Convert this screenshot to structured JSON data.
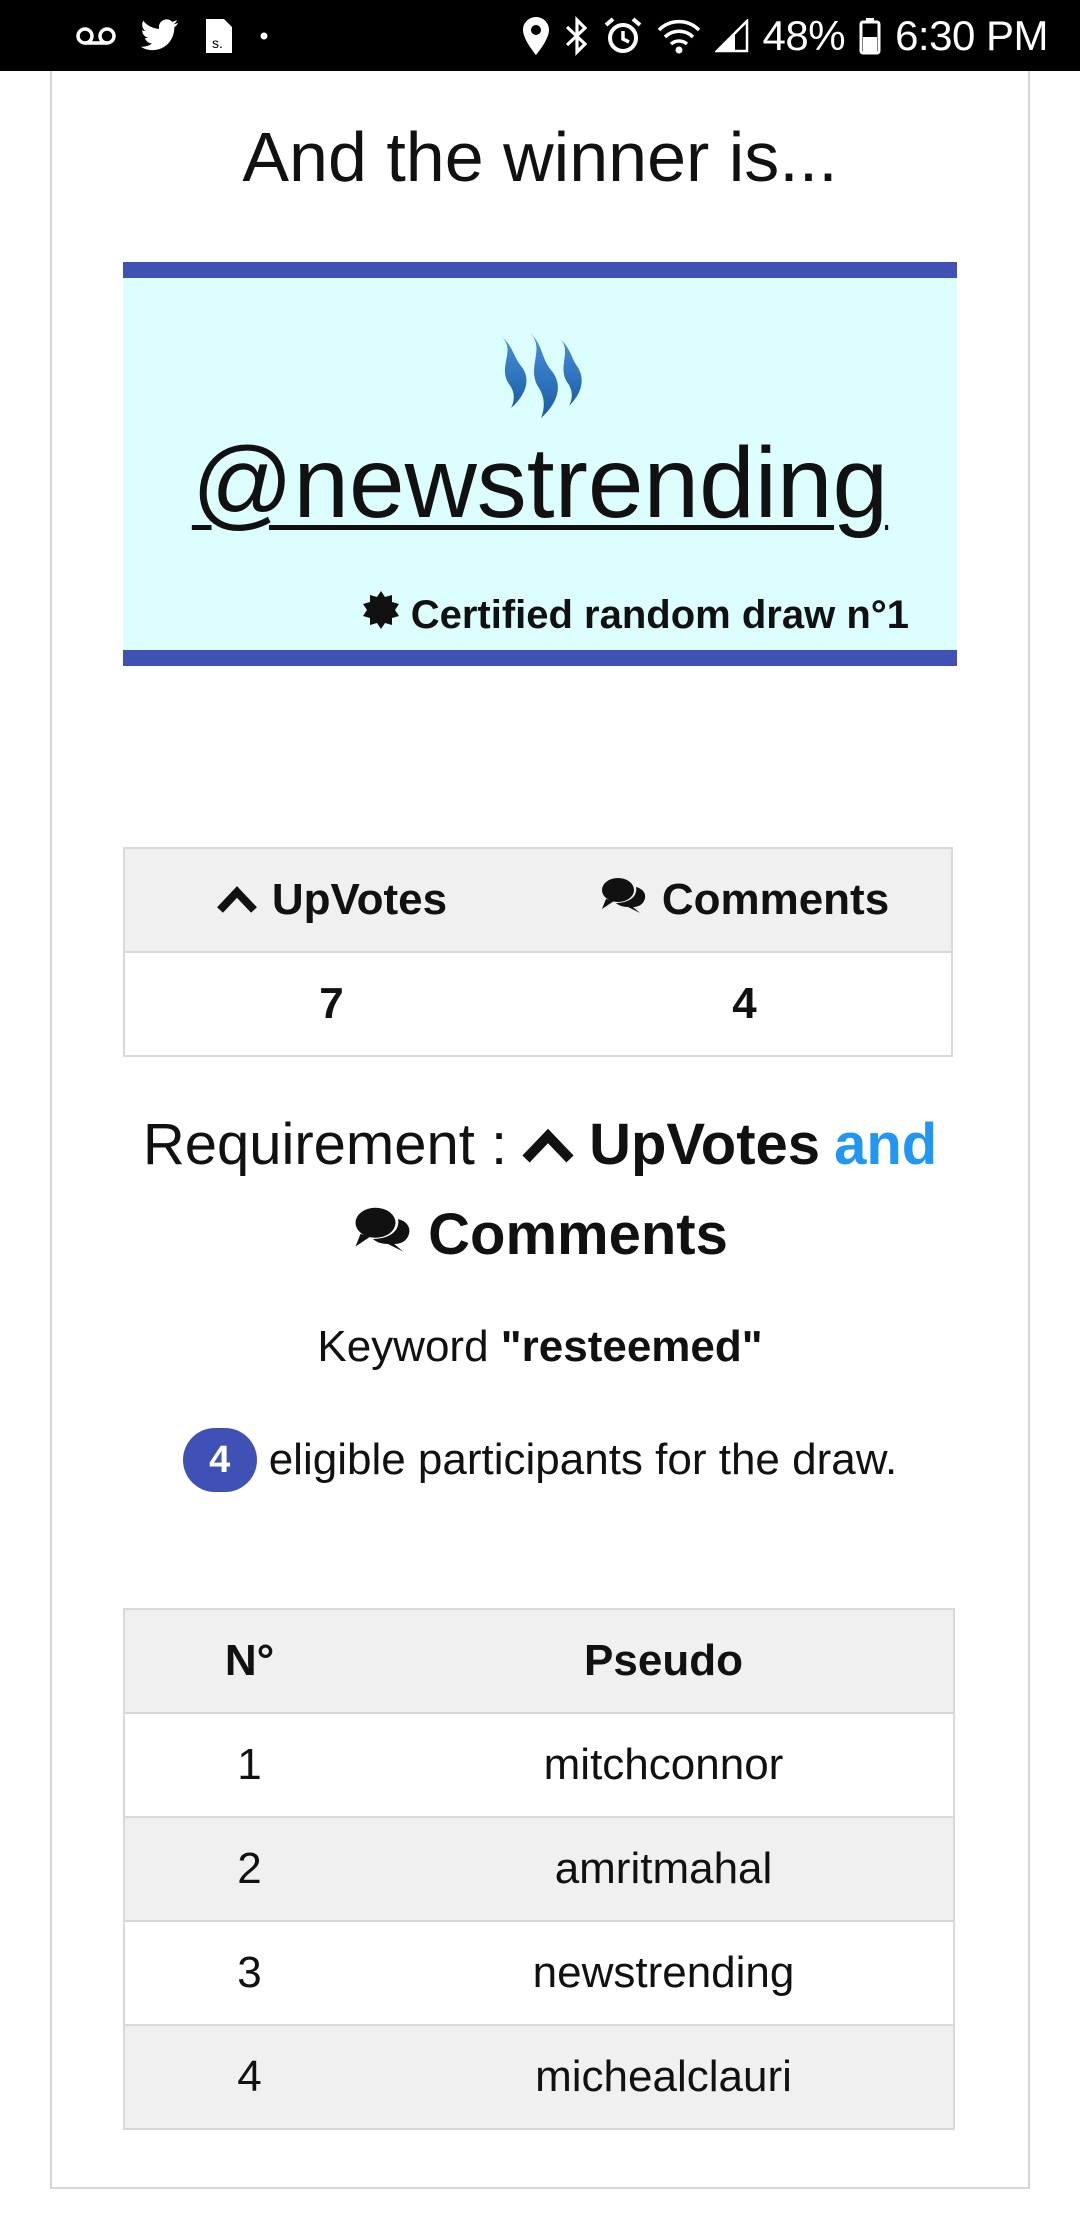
{
  "status_bar": {
    "battery": "48%",
    "time": "6:30 PM",
    "icons": [
      "voicemail-icon",
      "twitter-icon",
      "sim-icon",
      "dot-icon",
      "location-icon",
      "bluetooth-icon",
      "alarm-icon",
      "wifi-icon",
      "signal-icon",
      "battery-icon"
    ]
  },
  "heading": "And the winner is...",
  "winner": {
    "name": "@newstrending",
    "certified_label": "Certified random draw n°1",
    "logo_icon": "steem-logo-icon",
    "accent_color": "#3f51b5",
    "box_color": "#dcfefe"
  },
  "stats": {
    "upvotes_label": "UpVotes",
    "comments_label": "Comments",
    "upvotes_value": "7",
    "comments_value": "4"
  },
  "requirement": {
    "prefix": "Requirement :",
    "upvotes": "UpVotes",
    "and": "and",
    "comments": "Comments",
    "and_color": "#2196f3"
  },
  "keyword": {
    "label": "Keyword",
    "value": "\"resteemed\""
  },
  "eligible": {
    "count": "4",
    "text": "eligible participants for the draw."
  },
  "participants": {
    "headers": [
      "N°",
      "Pseudo"
    ],
    "rows": [
      [
        "1",
        "mitchconnor"
      ],
      [
        "2",
        "amritmahal"
      ],
      [
        "3",
        "newstrending"
      ],
      [
        "4",
        "michealclauri"
      ]
    ]
  }
}
